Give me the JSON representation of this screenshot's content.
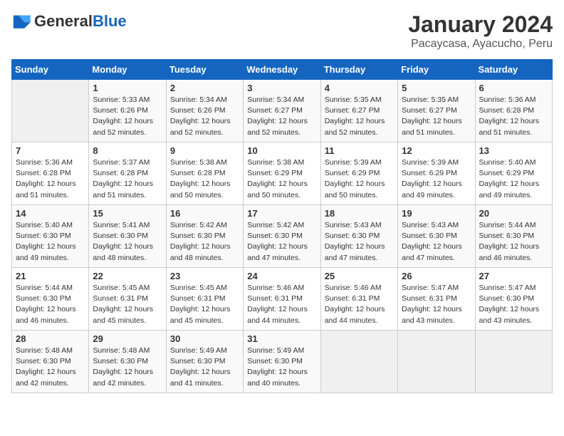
{
  "header": {
    "logo_general": "General",
    "logo_blue": "Blue",
    "title": "January 2024",
    "subtitle": "Pacaycasa, Ayacucho, Peru"
  },
  "columns": [
    "Sunday",
    "Monday",
    "Tuesday",
    "Wednesday",
    "Thursday",
    "Friday",
    "Saturday"
  ],
  "weeks": [
    [
      {
        "day": "",
        "info": ""
      },
      {
        "day": "1",
        "info": "Sunrise: 5:33 AM\nSunset: 6:26 PM\nDaylight: 12 hours\nand 52 minutes."
      },
      {
        "day": "2",
        "info": "Sunrise: 5:34 AM\nSunset: 6:26 PM\nDaylight: 12 hours\nand 52 minutes."
      },
      {
        "day": "3",
        "info": "Sunrise: 5:34 AM\nSunset: 6:27 PM\nDaylight: 12 hours\nand 52 minutes."
      },
      {
        "day": "4",
        "info": "Sunrise: 5:35 AM\nSunset: 6:27 PM\nDaylight: 12 hours\nand 52 minutes."
      },
      {
        "day": "5",
        "info": "Sunrise: 5:35 AM\nSunset: 6:27 PM\nDaylight: 12 hours\nand 51 minutes."
      },
      {
        "day": "6",
        "info": "Sunrise: 5:36 AM\nSunset: 6:28 PM\nDaylight: 12 hours\nand 51 minutes."
      }
    ],
    [
      {
        "day": "7",
        "info": "Sunrise: 5:36 AM\nSunset: 6:28 PM\nDaylight: 12 hours\nand 51 minutes."
      },
      {
        "day": "8",
        "info": "Sunrise: 5:37 AM\nSunset: 6:28 PM\nDaylight: 12 hours\nand 51 minutes."
      },
      {
        "day": "9",
        "info": "Sunrise: 5:38 AM\nSunset: 6:28 PM\nDaylight: 12 hours\nand 50 minutes."
      },
      {
        "day": "10",
        "info": "Sunrise: 5:38 AM\nSunset: 6:29 PM\nDaylight: 12 hours\nand 50 minutes."
      },
      {
        "day": "11",
        "info": "Sunrise: 5:39 AM\nSunset: 6:29 PM\nDaylight: 12 hours\nand 50 minutes."
      },
      {
        "day": "12",
        "info": "Sunrise: 5:39 AM\nSunset: 6:29 PM\nDaylight: 12 hours\nand 49 minutes."
      },
      {
        "day": "13",
        "info": "Sunrise: 5:40 AM\nSunset: 6:29 PM\nDaylight: 12 hours\nand 49 minutes."
      }
    ],
    [
      {
        "day": "14",
        "info": "Sunrise: 5:40 AM\nSunset: 6:30 PM\nDaylight: 12 hours\nand 49 minutes."
      },
      {
        "day": "15",
        "info": "Sunrise: 5:41 AM\nSunset: 6:30 PM\nDaylight: 12 hours\nand 48 minutes."
      },
      {
        "day": "16",
        "info": "Sunrise: 5:42 AM\nSunset: 6:30 PM\nDaylight: 12 hours\nand 48 minutes."
      },
      {
        "day": "17",
        "info": "Sunrise: 5:42 AM\nSunset: 6:30 PM\nDaylight: 12 hours\nand 47 minutes."
      },
      {
        "day": "18",
        "info": "Sunrise: 5:43 AM\nSunset: 6:30 PM\nDaylight: 12 hours\nand 47 minutes."
      },
      {
        "day": "19",
        "info": "Sunrise: 5:43 AM\nSunset: 6:30 PM\nDaylight: 12 hours\nand 47 minutes."
      },
      {
        "day": "20",
        "info": "Sunrise: 5:44 AM\nSunset: 6:30 PM\nDaylight: 12 hours\nand 46 minutes."
      }
    ],
    [
      {
        "day": "21",
        "info": "Sunrise: 5:44 AM\nSunset: 6:30 PM\nDaylight: 12 hours\nand 46 minutes."
      },
      {
        "day": "22",
        "info": "Sunrise: 5:45 AM\nSunset: 6:31 PM\nDaylight: 12 hours\nand 45 minutes."
      },
      {
        "day": "23",
        "info": "Sunrise: 5:45 AM\nSunset: 6:31 PM\nDaylight: 12 hours\nand 45 minutes."
      },
      {
        "day": "24",
        "info": "Sunrise: 5:46 AM\nSunset: 6:31 PM\nDaylight: 12 hours\nand 44 minutes."
      },
      {
        "day": "25",
        "info": "Sunrise: 5:46 AM\nSunset: 6:31 PM\nDaylight: 12 hours\nand 44 minutes."
      },
      {
        "day": "26",
        "info": "Sunrise: 5:47 AM\nSunset: 6:31 PM\nDaylight: 12 hours\nand 43 minutes."
      },
      {
        "day": "27",
        "info": "Sunrise: 5:47 AM\nSunset: 6:30 PM\nDaylight: 12 hours\nand 43 minutes."
      }
    ],
    [
      {
        "day": "28",
        "info": "Sunrise: 5:48 AM\nSunset: 6:30 PM\nDaylight: 12 hours\nand 42 minutes."
      },
      {
        "day": "29",
        "info": "Sunrise: 5:48 AM\nSunset: 6:30 PM\nDaylight: 12 hours\nand 42 minutes."
      },
      {
        "day": "30",
        "info": "Sunrise: 5:49 AM\nSunset: 6:30 PM\nDaylight: 12 hours\nand 41 minutes."
      },
      {
        "day": "31",
        "info": "Sunrise: 5:49 AM\nSunset: 6:30 PM\nDaylight: 12 hours\nand 40 minutes."
      },
      {
        "day": "",
        "info": ""
      },
      {
        "day": "",
        "info": ""
      },
      {
        "day": "",
        "info": ""
      }
    ]
  ]
}
